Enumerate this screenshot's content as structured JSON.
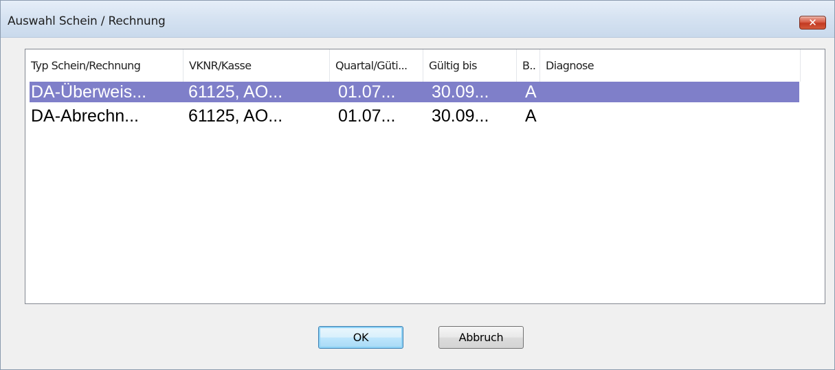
{
  "window": {
    "title": "Auswahl Schein / Rechnung",
    "close_label": "✕"
  },
  "list": {
    "columns": [
      "Typ Schein/Rechnung",
      "VKNR/Kasse",
      "Quartal/Güti...",
      "Gültig bis",
      "B..",
      "Diagnose"
    ],
    "rows": [
      {
        "typ": "DA-Überweis...",
        "vknr": "61125, AO...",
        "quartal": "01.07...",
        "gueltig": "30.09...",
        "b": "A",
        "diagnose": "",
        "selected": true
      },
      {
        "typ": "DA-Abrechn...",
        "vknr": "61125, AO...",
        "quartal": "01.07...",
        "gueltig": "30.09...",
        "b": "A",
        "diagnose": "",
        "selected": false
      }
    ]
  },
  "buttons": {
    "ok_label": "OK",
    "cancel_label": "Abbruch"
  },
  "colors": {
    "selection": "#7f7fc9",
    "close_button": "#c8432a",
    "default_button_border": "#3c7fb1"
  }
}
